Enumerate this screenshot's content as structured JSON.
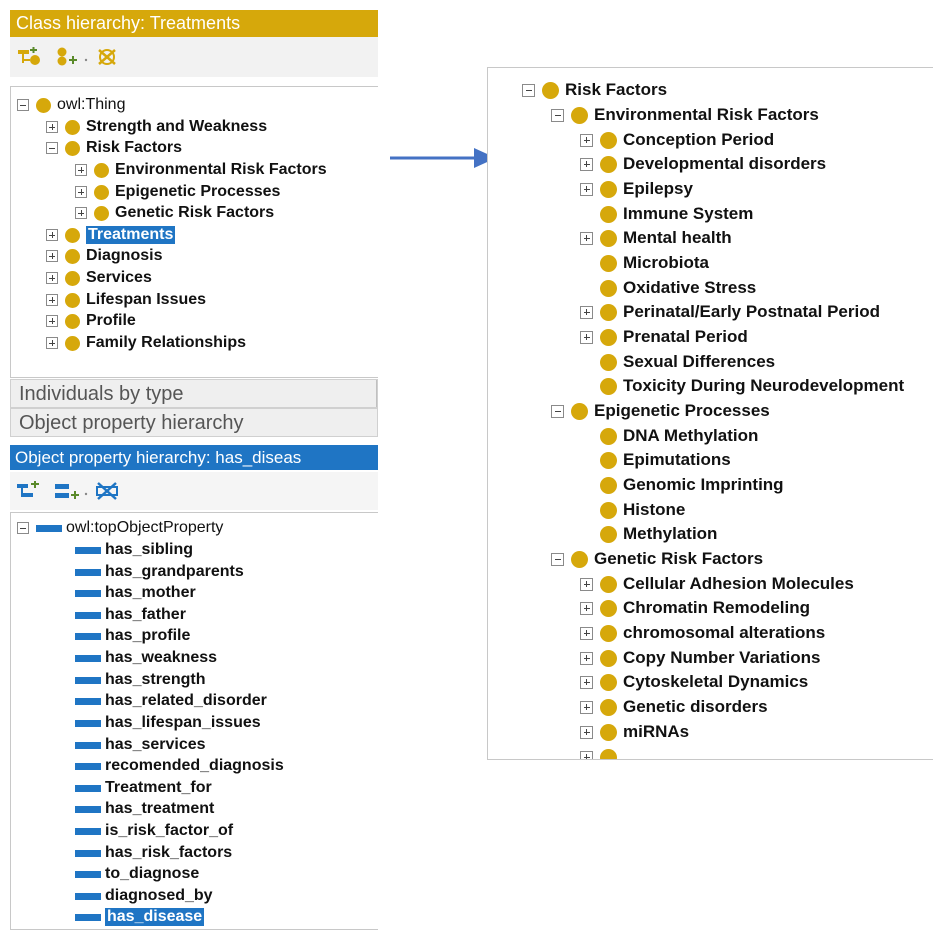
{
  "class_hierarchy": {
    "title": "Class hierarchy: Treatments",
    "toolbar": [
      "add-subclass-icon",
      "add-sibling-icon",
      "delete-class-icon"
    ],
    "root": "owl:Thing",
    "items": [
      "Strength and Weakness",
      "Risk Factors",
      "Environmental Risk Factors",
      "Epigenetic Processes",
      "Genetic Risk Factors",
      "Treatments",
      "Diagnosis",
      "Services",
      "Lifespan Issues",
      "Profile",
      "Family Relationships"
    ]
  },
  "tabs": {
    "individuals": "Individuals by type",
    "object_property": "Object property hierarchy"
  },
  "object_property_hierarchy": {
    "title": "Object property hierarchy: has_diseas",
    "toolbar": [
      "add-subproperty-icon",
      "add-sibling-property-icon",
      "delete-property-icon"
    ],
    "root": "owl:topObjectProperty",
    "properties": [
      "has_sibling",
      "has_grandparents",
      "has_mother",
      "has_father",
      "has_profile",
      "has_weakness",
      "has_strength",
      "has_related_disorder",
      "has_lifespan_issues",
      "has_services",
      "recomended_diagnosis",
      "Treatment_for",
      "has_treatment",
      "is_risk_factor_of",
      "has_risk_factors",
      "to_diagnose",
      "diagnosed_by",
      "has_disease"
    ]
  },
  "expanded_tree": {
    "root": "Risk Factors",
    "environmental": {
      "label": "Environmental Risk Factors",
      "children": [
        "Conception Period",
        "Developmental disorders",
        "Epilepsy",
        "Immune System",
        "Mental health",
        "Microbiota",
        "Oxidative Stress",
        "Perinatal/Early Postnatal Period",
        "Prenatal Period",
        "Sexual Differences",
        "Toxicity During Neurodevelopment"
      ]
    },
    "epigenetic": {
      "label": "Epigenetic Processes",
      "children": [
        "DNA Methylation",
        "Epimutations",
        "Genomic Imprinting",
        "Histone",
        "Methylation"
      ]
    },
    "genetic": {
      "label": "Genetic Risk Factors",
      "children": [
        "Cellular Adhesion Molecules",
        "Chromatin Remodeling",
        "chromosomal alterations",
        "Copy Number Variations",
        "Cytoskeletal Dynamics",
        "Genetic disorders",
        "miRNAs"
      ]
    }
  },
  "colors": {
    "class_accent": "#d6a80b",
    "property_accent": "#1f75c4",
    "arrow": "#4472c4"
  }
}
